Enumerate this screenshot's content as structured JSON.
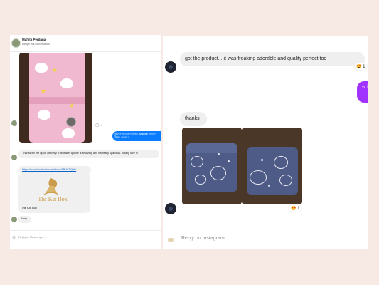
{
  "left": {
    "header": {
      "name": "Mahita Perdana",
      "subtitle": "Assign this conversation"
    },
    "outgoing_text": "আসসালামু আলাইকুম, Mahita! ধন্যবাদ উত্তর দেবেন।",
    "messages": {
      "thanks": "Thanks for the quick delivery! The wallet quality is amazing and it's really spacious. Totally love it!",
      "link": "https://www.facebook.com/share/1BvN7fQz6/",
      "link_card_title": "The Kat Box",
      "logo_text": "The Kat Box",
      "sorry": "Sorry"
    },
    "compose_placeholder": "Reply in Messenger..."
  },
  "right": {
    "message1": "got the product... it was freaking adorable and quality perfect too",
    "reaction1": "1",
    "purple_text": "অ উ",
    "thanks": "thanks",
    "reaction2": "1",
    "compose_placeholder": "Reply on Instagram..."
  },
  "colors": {
    "background": "#f7e9e4",
    "messenger_blue": "#0a7cff",
    "instagram_purple": "#a033ff",
    "bubble_grey": "#efefef"
  },
  "icons": [
    "plus-icon",
    "seen-check-icon",
    "reaction-emoji-icon",
    "avatar"
  ]
}
